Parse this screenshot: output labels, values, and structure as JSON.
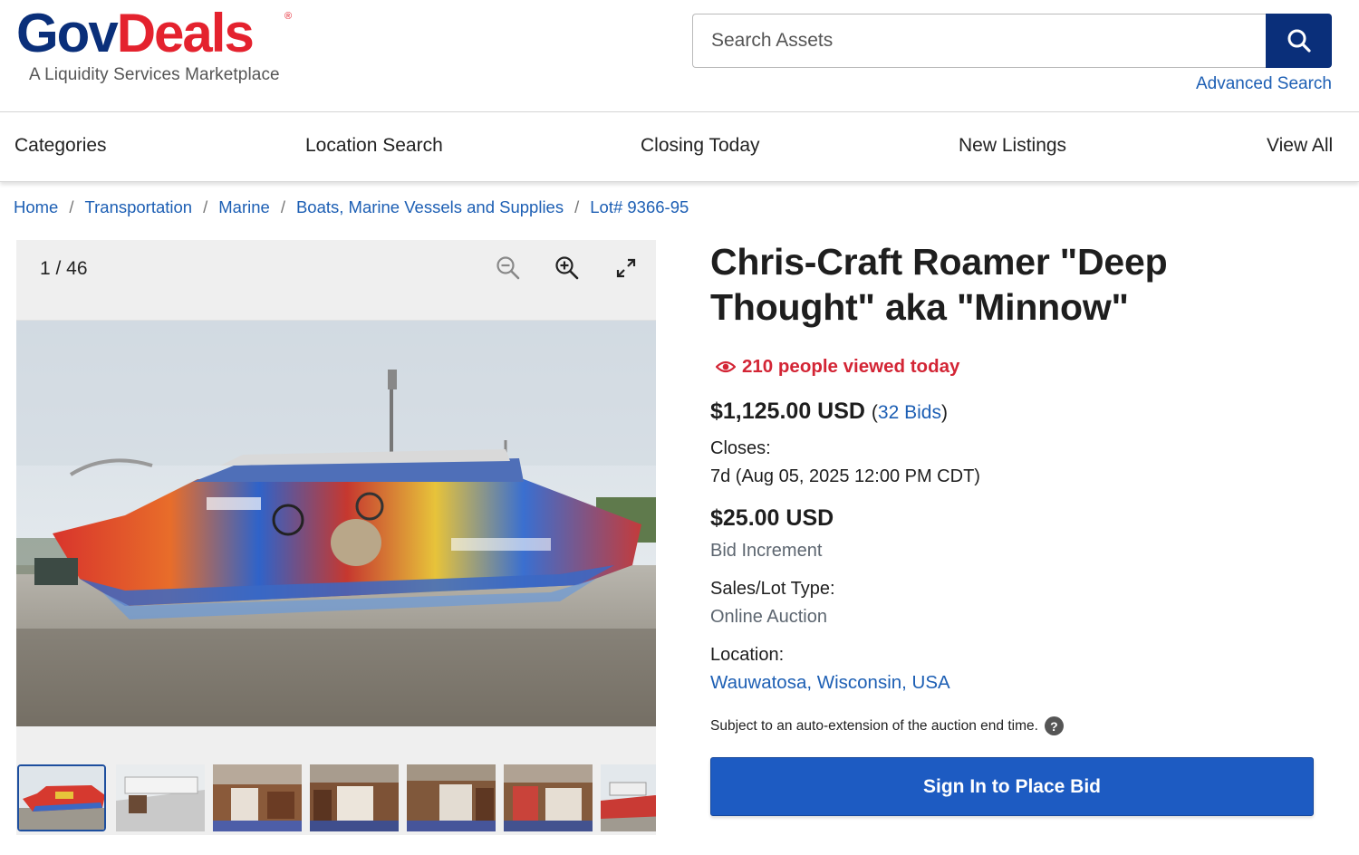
{
  "logo": {
    "main_gov": "Gov",
    "main_deals": "Deals",
    "registered": "®",
    "tagline": "A Liquidity Services Marketplace"
  },
  "search": {
    "placeholder": "Search Assets",
    "advanced_link": "Advanced Search"
  },
  "nav": [
    "Categories",
    "Location Search",
    "Closing Today",
    "New Listings",
    "View All"
  ],
  "breadcrumb": [
    "Home",
    "Transportation",
    "Marine",
    "Boats, Marine Vessels and Supplies",
    "Lot# 9366-95"
  ],
  "gallery": {
    "counter": "1 / 46",
    "thumbnail_count_visible": 7
  },
  "listing": {
    "title": "Chris-Craft Roamer \"Deep Thought\" aka \"Minnow\"",
    "views": "210 people viewed today",
    "current_price": "$1,125.00 USD",
    "bids_open": "(",
    "bids_link": "32 Bids",
    "bids_close": ")",
    "closes_label": "Closes:",
    "closes_value": "7d (Aug 05, 2025 12:00 PM CDT)",
    "increment_amount": "$25.00 USD",
    "increment_label": "Bid Increment",
    "sales_type_label": "Sales/Lot Type:",
    "sales_type_value": "Online Auction",
    "location_label": "Location:",
    "location_value": "Wauwatosa, Wisconsin, USA",
    "auto_extension_notice": "Subject to an auto-extension of the auction end time.",
    "help_glyph": "?",
    "bid_button": "Sign In to Place Bid"
  },
  "colors": {
    "brand_navy": "#0a2f7a",
    "brand_red": "#e4222e",
    "link_blue": "#1d5fb4",
    "alert_red": "#d32535",
    "button_blue": "#1d5bc2"
  },
  "icons": [
    "search-icon",
    "zoom-out-icon",
    "zoom-in-icon",
    "fullscreen-icon",
    "eye-icon",
    "help-icon"
  ]
}
